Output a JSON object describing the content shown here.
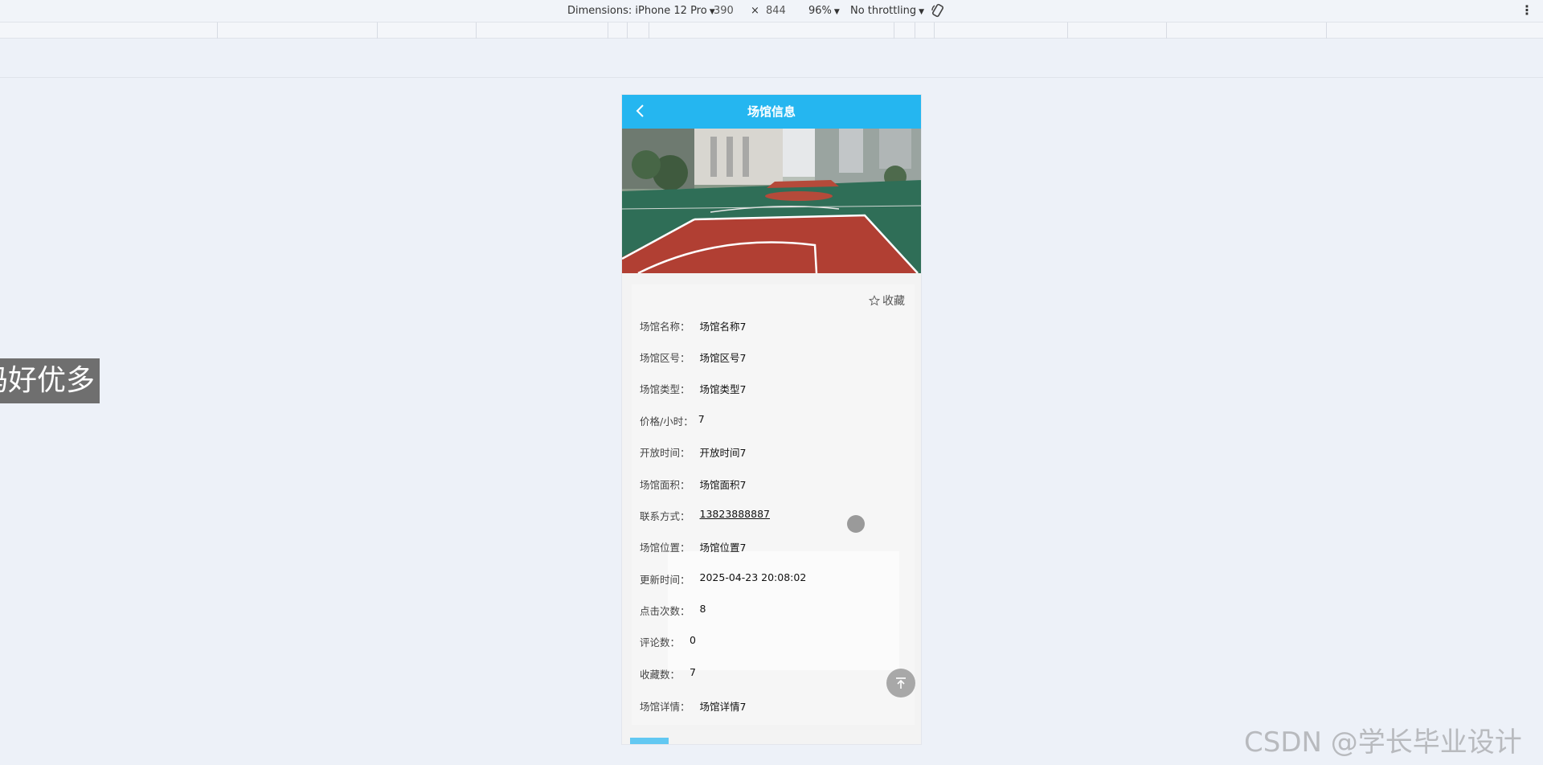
{
  "devtools": {
    "dimensions_label": "Dimensions: iPhone 12 Pro",
    "width": "390",
    "times": "×",
    "height": "844",
    "zoom": "96%",
    "throttle": "No throttling"
  },
  "overlay": {
    "text": "码好优多"
  },
  "page": {
    "title": "场馆信息",
    "favorite_label": "收藏",
    "fields": [
      {
        "label": "场馆名称：",
        "value": "场馆名称7"
      },
      {
        "label": "场馆区号：",
        "value": "场馆区号7"
      },
      {
        "label": "场馆类型：",
        "value": "场馆类型7"
      },
      {
        "label": "价格/小时：",
        "value": "7"
      },
      {
        "label": "开放时间：",
        "value": "开放时间7"
      },
      {
        "label": "场馆面积：",
        "value": "场馆面积7"
      },
      {
        "label": "联系方式：",
        "value": "13823888887"
      },
      {
        "label": "场馆位置：",
        "value": "场馆位置7"
      },
      {
        "label": "更新时间：",
        "value": "2025-04-23 20:08:02"
      },
      {
        "label": "点击次数：",
        "value": "8"
      },
      {
        "label": "评论数：",
        "value": "0"
      },
      {
        "label": "收藏数：",
        "value": "7"
      },
      {
        "label": "场馆详情：",
        "value": "场馆详情7"
      }
    ]
  },
  "watermark": {
    "text": "CSDN @学长毕业设计"
  },
  "colors": {
    "header": "#25b6f0",
    "accent_button": "#62c8f2"
  },
  "icons": {
    "back": "chevron-left-icon",
    "favorite": "star-outline-icon",
    "to_top": "arrow-up-to-top-icon",
    "rotate": "rotate-device-icon",
    "more": "more-vertical-icon"
  }
}
